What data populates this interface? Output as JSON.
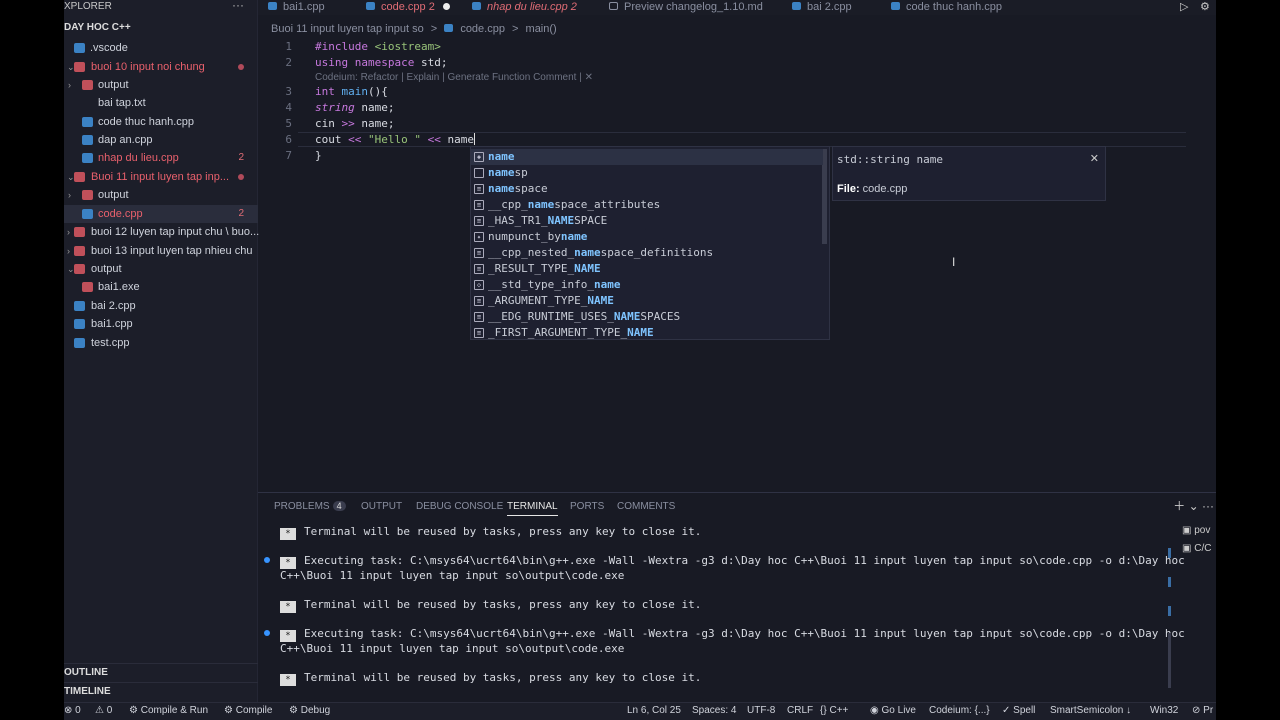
{
  "explorer": {
    "header": "XPLORER",
    "project": "DAY HOC C++",
    "items": [
      {
        "label": ".vscode",
        "kind": "folder"
      },
      {
        "label": "buoi 10 input noi chung",
        "kind": "folder",
        "status": "dot"
      },
      {
        "label": "output",
        "kind": "folder"
      },
      {
        "label": "bai tap.txt",
        "kind": "file"
      },
      {
        "label": "code thuc hanh.cpp",
        "kind": "file"
      },
      {
        "label": "dap an.cpp",
        "kind": "file"
      },
      {
        "label": "nhap du lieu.cpp",
        "kind": "file",
        "badge": "2"
      },
      {
        "label": "Buoi 11 input luyen tap inp...",
        "kind": "folder",
        "status": "dot"
      },
      {
        "label": "output",
        "kind": "folder"
      },
      {
        "label": "code.cpp",
        "kind": "file",
        "badge": "2"
      },
      {
        "label": "buoi 12 luyen tap input chu \\ buo...",
        "kind": "folder"
      },
      {
        "label": "buoi 13 input luyen tap nhieu chu",
        "kind": "folder"
      },
      {
        "label": "output",
        "kind": "folder"
      },
      {
        "label": "bai1.exe",
        "kind": "file"
      },
      {
        "label": "bai 2.cpp",
        "kind": "file"
      },
      {
        "label": "bai1.cpp",
        "kind": "file"
      },
      {
        "label": "test.cpp",
        "kind": "file"
      }
    ],
    "outline": "OUTLINE",
    "timeline": "TIMELINE"
  },
  "tabs": [
    {
      "label": "bai1.cpp"
    },
    {
      "label": "code.cpp 2"
    },
    {
      "label": "nhap du lieu.cpp 2"
    },
    {
      "label": "Preview changelog_1.10.md"
    },
    {
      "label": "bai 2.cpp"
    },
    {
      "label": "code thuc hanh.cpp"
    }
  ],
  "breadcrumb": {
    "folder": "Buoi 11 input luyen tap input so",
    "sep": ">",
    "file": "code.cpp",
    "symbol": "main()"
  },
  "editor": {
    "lines": [
      "1",
      "2",
      "3",
      "4",
      "5",
      "6",
      "7"
    ],
    "codeium_lens": "Codeium: Refactor | Explain | Generate Function Comment | ✕",
    "l1_a": "#include ",
    "l1_b": "<iostream>",
    "l2_a": "using namespace",
    "l2_b": " std;",
    "l3_a": "int",
    "l3_b": " main",
    "l3_c": "(){",
    "l4_a": "string",
    "l4_b": " name;",
    "l5_a": "cin ",
    "l5_b": ">>",
    "l5_c": " name;",
    "l6_a": "cout ",
    "l6_b": "<<",
    "l6_c": " \"Hello \" ",
    "l6_d": "<<",
    "l6_e": " name",
    "l7": "}"
  },
  "suggest": {
    "items": [
      {
        "pre": "",
        "match": "name",
        "post": "",
        "icon": "variable"
      },
      {
        "pre": "",
        "match": "name",
        "post": "sp",
        "icon": "namespace"
      },
      {
        "pre": "",
        "match": "name",
        "post": "space",
        "icon": "keyword"
      },
      {
        "pre": "__cpp_",
        "match": "name",
        "post": "space_attributes",
        "icon": "keyword"
      },
      {
        "pre": "_HAS_TR1_",
        "match": "NAME",
        "post": "SPACE",
        "icon": "keyword"
      },
      {
        "pre": "numpunct_by",
        "match": "name",
        "post": "",
        "icon": "class"
      },
      {
        "pre": "__cpp_nested_",
        "match": "name",
        "post": "space_definitions",
        "icon": "keyword"
      },
      {
        "pre": "_RESULT_TYPE_",
        "match": "NAME",
        "post": "",
        "icon": "keyword"
      },
      {
        "pre": "__std_type_info_",
        "match": "name",
        "post": "",
        "icon": "struct"
      },
      {
        "pre": "_ARGUMENT_TYPE_",
        "match": "NAME",
        "post": "",
        "icon": "keyword"
      },
      {
        "pre": "__EDG_RUNTIME_USES_",
        "match": "NAME",
        "post": "SPACES",
        "icon": "keyword"
      },
      {
        "pre": "_FIRST_ARGUMENT_TYPE_",
        "match": "NAME",
        "post": "",
        "icon": "keyword"
      }
    ],
    "details": {
      "signature": "std::string name",
      "file_label": "File:",
      "file_value": " code.cpp",
      "close": "✕"
    }
  },
  "panel": {
    "tabs": [
      "PROBLEMS",
      "OUTPUT",
      "DEBUG CONSOLE",
      "TERMINAL",
      "PORTS",
      "COMMENTS"
    ],
    "problems_count": "4",
    "terminal": [
      "Terminal will be reused by tasks, press any key to close it.",
      "Executing task: C:\\msys64\\ucrt64\\bin\\g++.exe -Wall -Wextra -g3 d:\\Day hoc C++\\Buoi 11 input luyen tap input so\\code.cpp -o d:\\Day hoc",
      "C++\\Buoi 11 input luyen tap input so\\output\\code.exe",
      "Terminal will be reused by tasks, press any key to close it.",
      "Executing task: C:\\msys64\\ucrt64\\bin\\g++.exe -Wall -Wextra -g3 d:\\Day hoc C++\\Buoi 11 input luyen tap input so\\code.cpp -o d:\\Day hoc",
      "C++\\Buoi 11 input luyen tap input so\\output\\code.exe",
      "Terminal will be reused by tasks, press any key to close it."
    ],
    "terminal_list": [
      "pov",
      "C/C"
    ]
  },
  "status": {
    "errors": "0",
    "warnings": "0",
    "compile_run": "Compile & Run",
    "compile": "Compile",
    "debug": "Debug",
    "position": "Ln 6, Col 25",
    "spaces": "Spaces: 4",
    "encoding": "UTF-8",
    "eol": "CRLF",
    "language": "C++",
    "golive": "Go Live",
    "codeium": "Codeium: {...}",
    "spell": "Spell",
    "smartsemi": "SmartSemicolon",
    "platform": "Win32",
    "pr": "Pr"
  }
}
